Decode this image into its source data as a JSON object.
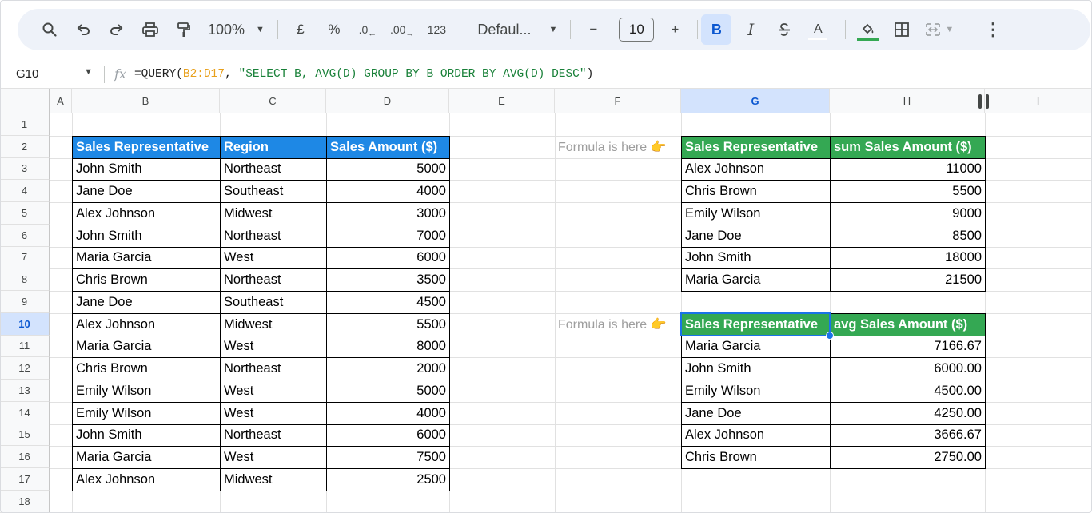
{
  "toolbar": {
    "zoom": "100%",
    "currency": "£",
    "percent": "%",
    "dec_decrease": ".0",
    "dec_increase": ".00",
    "number_format": "123",
    "font": "Defaul...",
    "font_size": "10",
    "minus": "−",
    "plus": "+",
    "bold": "B",
    "italic": "I",
    "text_color": "A",
    "more": "⋮"
  },
  "formula_bar": {
    "cell_ref": "G10",
    "fx": "fx",
    "formula_prefix": "=QUERY(",
    "formula_range": "B2:D17",
    "formula_sep": ", ",
    "formula_string": "\"SELECT B, AVG(D) GROUP BY B ORDER BY AVG(D) DESC\"",
    "formula_suffix": ")"
  },
  "columns": [
    "A",
    "B",
    "C",
    "D",
    "E",
    "F",
    "G",
    "H",
    "I"
  ],
  "rows": [
    "1",
    "2",
    "3",
    "4",
    "5",
    "6",
    "7",
    "8",
    "9",
    "10",
    "11",
    "12",
    "13",
    "14",
    "15",
    "16",
    "17",
    "18"
  ],
  "selected_cell": "G10",
  "table1": {
    "headers": [
      "Sales Representative",
      "Region",
      "Sales Amount ($)"
    ],
    "rows": [
      [
        "John Smith",
        "Northeast",
        "5000"
      ],
      [
        "Jane Doe",
        "Southeast",
        "4000"
      ],
      [
        "Alex Johnson",
        "Midwest",
        "3000"
      ],
      [
        "John Smith",
        "Northeast",
        "7000"
      ],
      [
        "Maria Garcia",
        "West",
        "6000"
      ],
      [
        "Chris Brown",
        "Northeast",
        "3500"
      ],
      [
        "Jane Doe",
        "Southeast",
        "4500"
      ],
      [
        "Alex Johnson",
        "Midwest",
        "5500"
      ],
      [
        "Maria Garcia",
        "West",
        "8000"
      ],
      [
        "Chris Brown",
        "Northeast",
        "2000"
      ],
      [
        "Emily Wilson",
        "West",
        "5000"
      ],
      [
        "Emily Wilson",
        "West",
        "4000"
      ],
      [
        "John Smith",
        "Northeast",
        "6000"
      ],
      [
        "Maria Garcia",
        "West",
        "7500"
      ],
      [
        "Alex Johnson",
        "Midwest",
        "2500"
      ]
    ]
  },
  "note1": "Formula is here 👉",
  "note2": "Formula is here 👉",
  "table2": {
    "headers": [
      "Sales Representative",
      "sum Sales Amount ($)"
    ],
    "rows": [
      [
        "Alex Johnson",
        "11000"
      ],
      [
        "Chris Brown",
        "5500"
      ],
      [
        "Emily Wilson",
        "9000"
      ],
      [
        "Jane Doe",
        "8500"
      ],
      [
        "John Smith",
        "18000"
      ],
      [
        "Maria Garcia",
        "21500"
      ]
    ]
  },
  "table3": {
    "headers": [
      "Sales Representative",
      "avg Sales Amount ($)"
    ],
    "rows": [
      [
        "Maria Garcia",
        "7166.67"
      ],
      [
        "John Smith",
        "6000.00"
      ],
      [
        "Emily Wilson",
        "4500.00"
      ],
      [
        "Jane Doe",
        "4250.00"
      ],
      [
        "Alex Johnson",
        "3666.67"
      ],
      [
        "Chris Brown",
        "2750.00"
      ]
    ]
  },
  "colors": {
    "header_blue": "#1e88e5",
    "header_green": "#34a853",
    "selection": "#1a73e8"
  }
}
